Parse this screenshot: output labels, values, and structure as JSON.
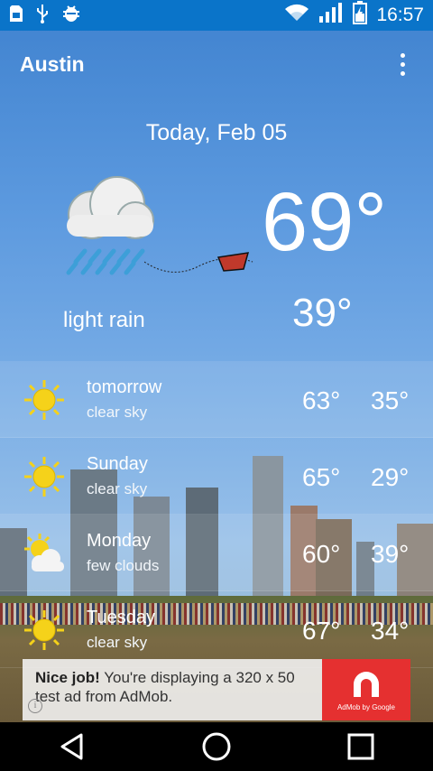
{
  "status_bar": {
    "time": "16:57",
    "icons": [
      "sd-card-icon",
      "usb-icon",
      "android-debug-icon",
      "wifi-icon",
      "signal-icon",
      "battery-charging-icon"
    ]
  },
  "app_bar": {
    "city": "Austin",
    "menu_icon": "overflow-menu-icon"
  },
  "today": {
    "date": "Today, Feb 05",
    "high": "69°",
    "low": "39°",
    "condition": "light rain",
    "icon": "light-rain-icon"
  },
  "forecast": [
    {
      "day": "tomorrow",
      "desc": "clear sky",
      "high": "63°",
      "low": "35°",
      "icon": "sun-icon"
    },
    {
      "day": "Sunday",
      "desc": "clear sky",
      "high": "65°",
      "low": "29°",
      "icon": "sun-icon"
    },
    {
      "day": "Monday",
      "desc": "few clouds",
      "high": "60°",
      "low": "39°",
      "icon": "few-clouds-icon"
    },
    {
      "day": "Tuesday",
      "desc": "clear sky",
      "high": "67°",
      "low": "34°",
      "icon": "sun-icon"
    }
  ],
  "ad": {
    "headline": "Nice job!",
    "body": " You're displaying a 320 x 50 test ad from AdMob.",
    "logo_caption": "AdMob by Google",
    "info_glyph": "i"
  },
  "nav_bar": {
    "icons": [
      "back-icon",
      "home-icon",
      "recents-icon"
    ]
  },
  "colors": {
    "status_bar": "#0a74c9",
    "ad_logo": "#e53030",
    "sun": "#f5d21a"
  }
}
